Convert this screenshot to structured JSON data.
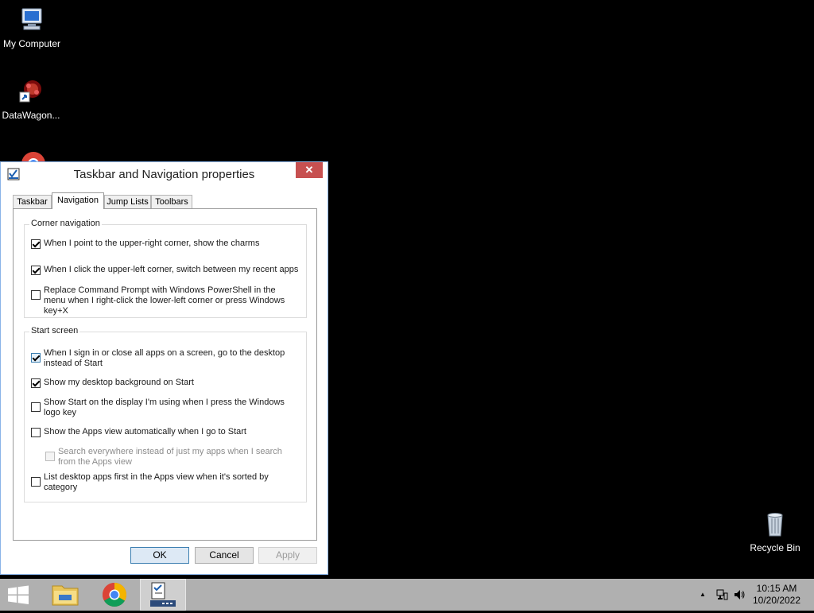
{
  "desktop": {
    "icons": [
      {
        "label": "My Computer"
      },
      {
        "label": "DataWagon..."
      },
      {
        "label": "Recycle Bin"
      }
    ]
  },
  "dialog": {
    "title": "Taskbar and Navigation properties",
    "close_glyph": "✕",
    "tabs": [
      "Taskbar",
      "Navigation",
      "Jump Lists",
      "Toolbars"
    ],
    "active_tab": "Navigation",
    "corner_group": {
      "title": "Corner navigation",
      "items": [
        {
          "label": "When I point to the upper-right corner, show the charms",
          "checked": true
        },
        {
          "label": "When I click the upper-left corner, switch between my recent apps",
          "checked": true
        },
        {
          "label": "Replace Command Prompt with Windows PowerShell in the menu when I right-click the lower-left corner or press Windows key+X",
          "checked": false
        }
      ]
    },
    "start_group": {
      "title": "Start screen",
      "items": [
        {
          "label": "When I sign in or close all apps on a screen, go to the desktop instead of Start",
          "checked": true
        },
        {
          "label": "Show my desktop background on Start",
          "checked": true
        },
        {
          "label": "Show Start on the display I'm using when I press the Windows logo key",
          "checked": false
        },
        {
          "label": "Show the Apps view automatically when I go to Start",
          "checked": false
        },
        {
          "label": "Search everywhere instead of just my apps when I search from the Apps view",
          "checked": false,
          "disabled": true
        },
        {
          "label": "List desktop apps first in the Apps view when it's sorted by category",
          "checked": false
        }
      ]
    },
    "buttons": {
      "ok": "OK",
      "cancel": "Cancel",
      "apply": "Apply"
    }
  },
  "taskbar": {
    "clock_time": "10:15 AM",
    "clock_date": "10/20/2022",
    "tray_chevron": "▲"
  }
}
